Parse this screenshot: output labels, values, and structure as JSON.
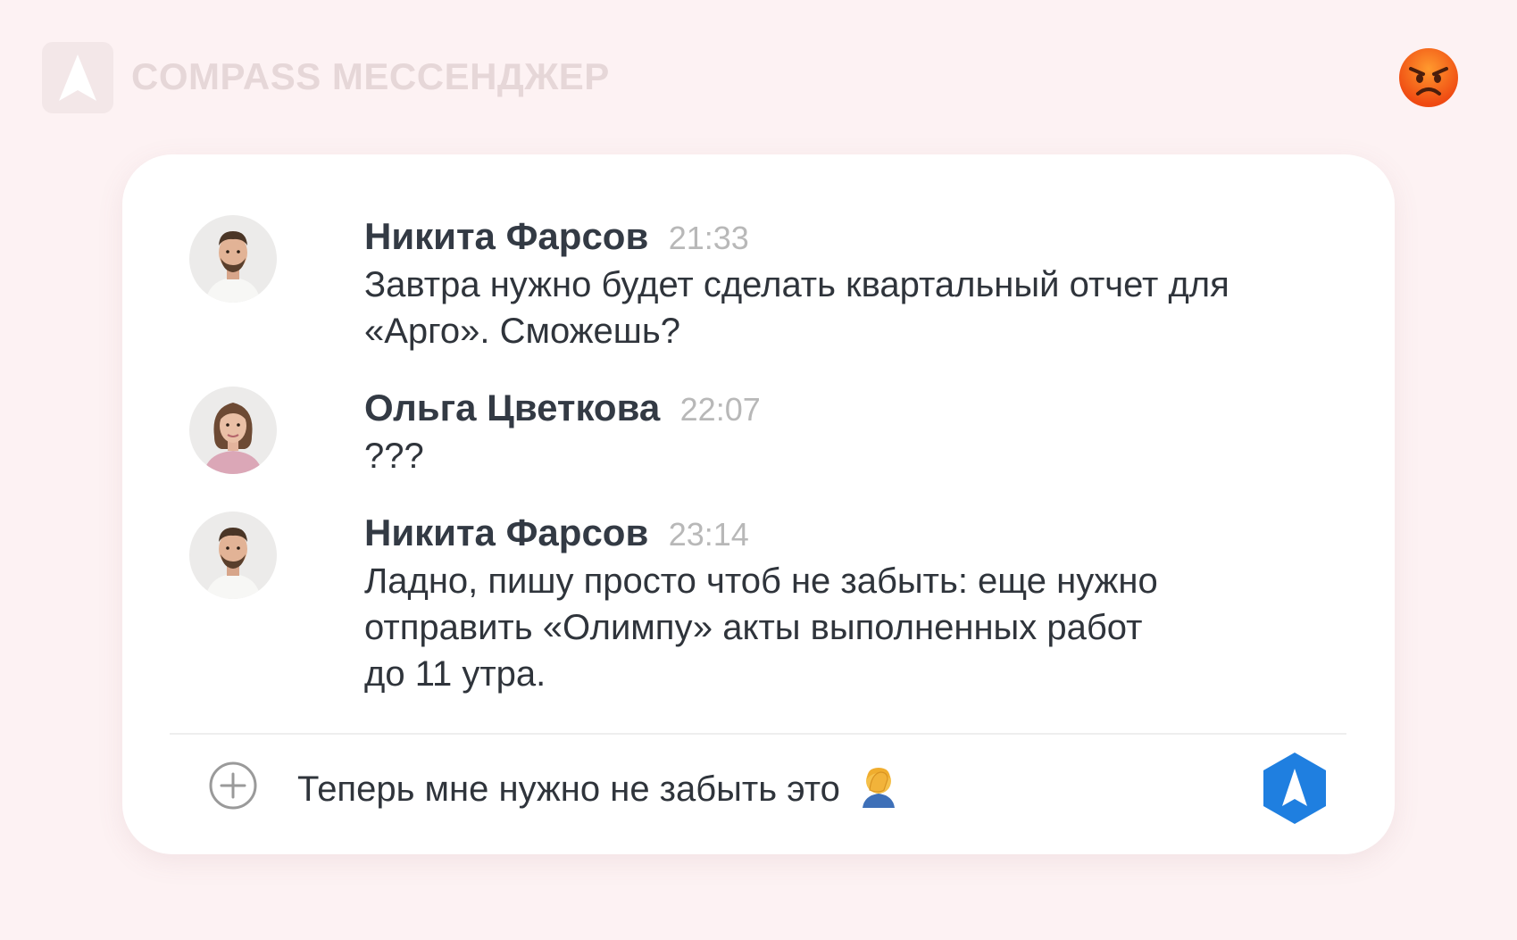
{
  "header": {
    "brand": "COMPASS МЕССЕНДЖЕР",
    "logo_icon": "compass-logo-icon",
    "status_icon": "angry-face-icon"
  },
  "messages": [
    {
      "author": "Никита Фарсов",
      "time": "21:33",
      "text_lines": [
        "Завтра нужно будет сделать квартальный отчет для",
        "«Арго». Сможешь?"
      ],
      "avatar": "man-avatar"
    },
    {
      "author": "Ольга Цветкова",
      "time": "22:07",
      "text_lines": [
        "???"
      ],
      "avatar": "woman-avatar"
    },
    {
      "author": "Никита Фарсов",
      "time": "23:14",
      "text_lines": [
        "Ладно, пишу просто чтоб не забыть: еще нужно",
        "отправить «Олимпу» акты выполненных работ",
        "до 11 утра."
      ],
      "avatar": "man-avatar"
    }
  ],
  "composer": {
    "text": "Теперь мне нужно не забыть это",
    "attach_icon": "plus-circle-icon",
    "emoji_icon": "facepalm-emoji-icon",
    "send_icon": "compass-send-icon"
  },
  "colors": {
    "background": "#fdf2f3",
    "accent": "#1f7fe0",
    "author": "#333a44",
    "timestamp": "#b8b8b8"
  }
}
